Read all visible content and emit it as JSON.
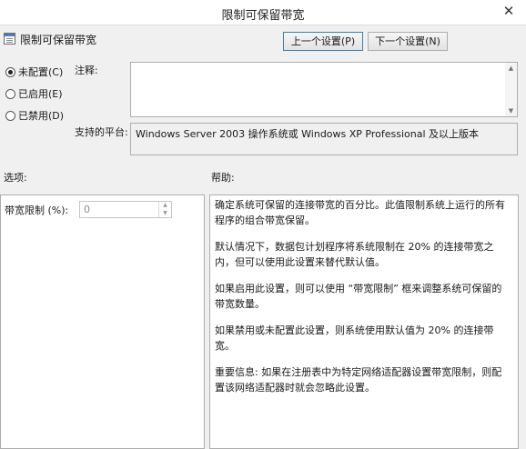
{
  "window": {
    "title": "限制可保留带宽",
    "close_glyph": "✕"
  },
  "policy": {
    "name": "限制可保留带宽"
  },
  "nav": {
    "prev_label": "上一个设置(P)",
    "next_label": "下一个设置(N)"
  },
  "state": {
    "options": [
      {
        "label": "未配置(C)",
        "checked": true
      },
      {
        "label": "已启用(E)",
        "checked": false
      },
      {
        "label": "已禁用(D)",
        "checked": false
      }
    ]
  },
  "comment": {
    "label": "注释:",
    "value": ""
  },
  "platform": {
    "label": "支持的平台:",
    "value": "Windows Server 2003 操作系统或 Windows XP Professional 及以上版本"
  },
  "sections": {
    "options_label": "选项:",
    "help_label": "帮助:"
  },
  "options_panel": {
    "bandwidth_label": "带宽限制 (%):",
    "bandwidth_value": "0"
  },
  "help": {
    "paragraphs": [
      "确定系统可保留的连接带宽的百分比。此值限制系统上运行的所有程序的组合带宽保留。",
      "默认情况下，数据包计划程序将系统限制在 20% 的连接带宽之内，但可以使用此设置来替代默认值。",
      "如果启用此设置，则可以使用 “带宽限制” 框来调整系统可保留的带宽数量。",
      "如果禁用或未配置此设置，则系统使用默认值为 20% 的连接带宽。",
      "重要信息: 如果在注册表中为特定网络适配器设置带宽限制，则配置该网络适配器时就会忽略此设置。"
    ]
  }
}
